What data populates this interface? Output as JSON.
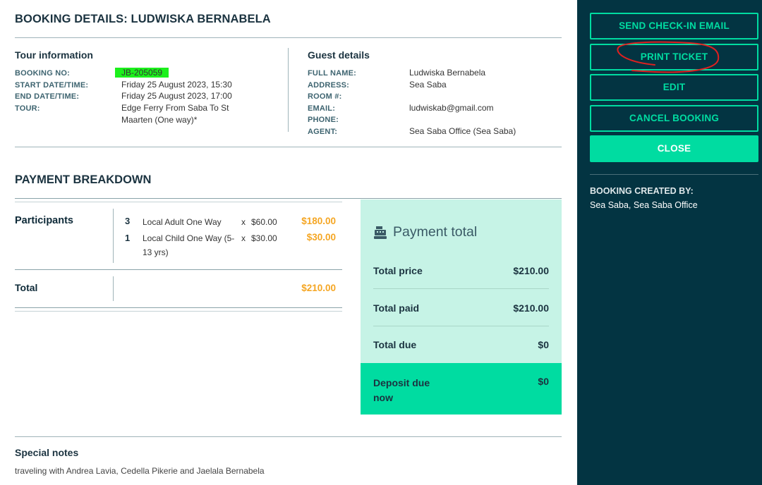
{
  "header": {
    "title": "BOOKING DETAILS:  LUDWISKA BERNABELA"
  },
  "tour_info": {
    "heading": "Tour information",
    "booking_no_label": "BOOKING NO:",
    "booking_no": "JB-205059",
    "start_label": "START DATE/TIME:",
    "start": "Friday 25 August 2023, 15:30",
    "end_label": "END DATE/TIME:",
    "end": "Friday 25 August 2023, 17:00",
    "tour_label": "TOUR:",
    "tour_line1": "Edge Ferry From Saba To St",
    "tour_line2": "Maarten (One way)*"
  },
  "guest": {
    "heading": "Guest details",
    "full_name_label": "FULL NAME:",
    "full_name": "Ludwiska Bernabela",
    "address_label": "ADDRESS:",
    "address": "Sea Saba",
    "room_label": "ROOM #:",
    "room": "",
    "email_label": "EMAIL:",
    "email": "ludwiskab@gmail.com",
    "phone_label": "PHONE:",
    "phone": "",
    "agent_label": "AGENT:",
    "agent": "Sea Saba Office (Sea Saba)"
  },
  "payment": {
    "heading": "PAYMENT BREAKDOWN",
    "participants_label": "Participants",
    "lines": [
      {
        "qty": "3",
        "name_l1": "Local Adult One Way",
        "name_l2": "",
        "x": "x",
        "unit": "$60.00",
        "amount": "$180.00"
      },
      {
        "qty": "1",
        "name_l1": "Local Child One Way (5-",
        "name_l2": "13 yrs)",
        "x": "x",
        "unit": "$30.00",
        "amount": "$30.00"
      }
    ],
    "total_label": "Total",
    "total_amount": "$210.00"
  },
  "payment_total": {
    "icon": "cash-register-icon",
    "title": "Payment total",
    "total_price_label": "Total price",
    "total_price": "$210.00",
    "total_paid_label": "Total paid",
    "total_paid": "$210.00",
    "total_due_label": "Total due",
    "total_due": "$0",
    "deposit_label_l1": "Deposit due",
    "deposit_label_l2": "now",
    "deposit_due": "$0"
  },
  "notes": {
    "heading": "Special notes",
    "text": "traveling with Andrea Lavia, Cedella Pikerie and Jaelala Bernabela"
  },
  "sidebar": {
    "buttons": {
      "send_checkin": "SEND CHECK-IN EMAIL",
      "print_ticket": "PRINT TICKET",
      "edit": "EDIT",
      "cancel": "CANCEL BOOKING",
      "close": "CLOSE"
    },
    "created_by_label": "BOOKING CREATED BY:",
    "created_by": "Sea Saba, Sea Saba Office"
  },
  "colors": {
    "sidebar_bg": "#033442",
    "accent": "#00dca1",
    "amount": "#f5a623",
    "summary_bg": "#c6f3e6",
    "highlight": "#1cf01c",
    "annotation": "#e02020"
  }
}
